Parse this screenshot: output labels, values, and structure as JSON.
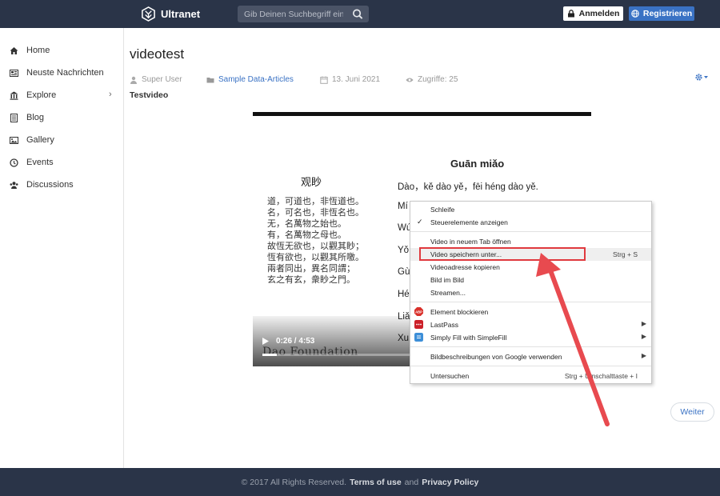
{
  "navbar": {
    "brand": "Ultranet",
    "search_placeholder": "Gib Deinen Suchbegriff ein",
    "login_label": "Anmelden",
    "register_label": "Registrieren",
    "colors": {
      "background": "#2a3448",
      "register": "#3a72c4"
    }
  },
  "sidebar": {
    "items": [
      {
        "label": "Home",
        "icon": "home-icon"
      },
      {
        "label": "Neuste Nachrichten",
        "icon": "newspaper-icon"
      },
      {
        "label": "Explore",
        "icon": "bank-icon",
        "has_submenu": true
      },
      {
        "label": "Blog",
        "icon": "blog-icon"
      },
      {
        "label": "Gallery",
        "icon": "image-icon"
      },
      {
        "label": "Events",
        "icon": "clock-icon"
      },
      {
        "label": "Discussions",
        "icon": "users-icon"
      }
    ],
    "chevron": "›"
  },
  "article": {
    "title": "videotest",
    "author": "Super User",
    "category": "Sample Data-Articles",
    "date": "13. Juni 2021",
    "hits": "Zugriffe: 25",
    "subtitle": "Testvideo"
  },
  "video": {
    "left_title": "观眇",
    "poem": "道，可道也，非恆道也。\n名，可名也，非恆名也。\n无，名萬物之始也。\n有，名萬物之母也。\n故恆无欲也，以觀其眇；\n恆有欲也，以觀其所噭。\n兩者同出，異名同謂；\n玄之有玄，衆眇之門。",
    "right_title": "Guān miǎo",
    "right_lines": [
      "Dào，kě dào yě，fēi héng dào yě.",
      "Mí",
      "Wú",
      "Yǒ",
      "Gù",
      "Hé",
      "Liǎ",
      "Xu"
    ],
    "watermark": "Dao Foundation",
    "time": "0:26 / 4:53",
    "progress": 0.09
  },
  "context_menu": {
    "items": [
      {
        "label": "Schleife"
      },
      {
        "label": "Steuerelemente anzeigen",
        "checked": true
      },
      {
        "label": "Video in neuem Tab öffnen"
      },
      {
        "label": "Video speichern unter...",
        "shortcut": "Strg + S",
        "highlighted": true
      },
      {
        "label": "Videoadresse kopieren"
      },
      {
        "label": "Bild im Bild"
      },
      {
        "label": "Streamen..."
      },
      {
        "label": "Element blockieren",
        "icon": "abp-icon"
      },
      {
        "label": "LastPass",
        "icon": "lastpass-icon",
        "submenu": true
      },
      {
        "label": "Simply Fill with SimpleFill",
        "icon": "simplefill-icon",
        "submenu": true
      },
      {
        "label": "Bildbeschreibungen von Google verwenden",
        "submenu": true
      },
      {
        "label": "Untersuchen",
        "shortcut": "Strg + Umschalttaste + I"
      }
    ],
    "check_mark": "✓",
    "submenu_arrow": "▶",
    "highlight_color": "#e0393e"
  },
  "pagination": {
    "next_label": "Weiter"
  },
  "footer": {
    "copyright": "© 2017 All Rights Reserved.",
    "terms": "Terms of use",
    "and": "and",
    "privacy": "Privacy Policy"
  }
}
